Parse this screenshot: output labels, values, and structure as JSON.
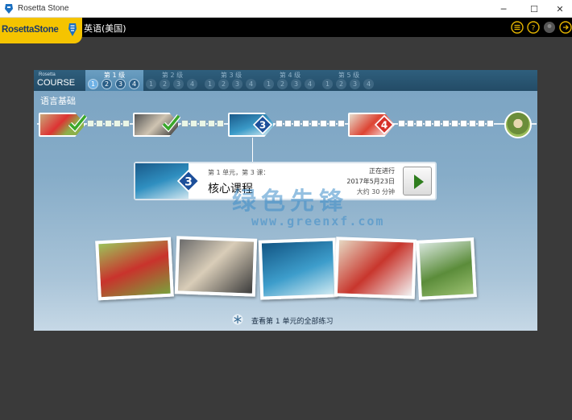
{
  "window": {
    "title": "Rosetta Stone",
    "minimize": "─",
    "maximize": "☐",
    "close": "✕"
  },
  "header": {
    "logo_text": "RosettaStone",
    "language": "英语(美国)",
    "icons": [
      "menu-list-icon",
      "help-icon",
      "account-icon",
      "exit-icon"
    ]
  },
  "course": {
    "logo_small": "Rosetta",
    "logo_big": "COURSE",
    "levels": [
      {
        "label": "第 1 级",
        "units": [
          "1",
          "2",
          "3",
          "4"
        ],
        "active": true
      },
      {
        "label": "第 2 级",
        "units": [
          "1",
          "2",
          "3",
          "4"
        ],
        "active": false
      },
      {
        "label": "第 3 级",
        "units": [
          "1",
          "2",
          "3",
          "4"
        ],
        "active": false
      },
      {
        "label": "第 4 级",
        "units": [
          "1",
          "2",
          "3",
          "4"
        ],
        "active": false
      },
      {
        "label": "第 5 级",
        "units": [
          "1",
          "2",
          "3",
          "4"
        ],
        "active": false
      }
    ]
  },
  "section": {
    "title": "语言基础"
  },
  "progress": {
    "lesson_badges": [
      "✔",
      "✔",
      "3",
      "4"
    ],
    "colors": {
      "check": "#3aa82a",
      "current": "#1d4f9a",
      "next": "#d6312a"
    }
  },
  "lesson_card": {
    "breadcrumb": "第 1 单元，第 3 课：",
    "title": "核心课程",
    "badge": "3",
    "status": "正在进行",
    "date": "2017年5月23日",
    "duration": "大约 30 分钟"
  },
  "footer": {
    "link": "查看第 1 单元的全部练习"
  },
  "watermark": {
    "cn": "绿色先锋",
    "url": "www.greenxf.com"
  }
}
